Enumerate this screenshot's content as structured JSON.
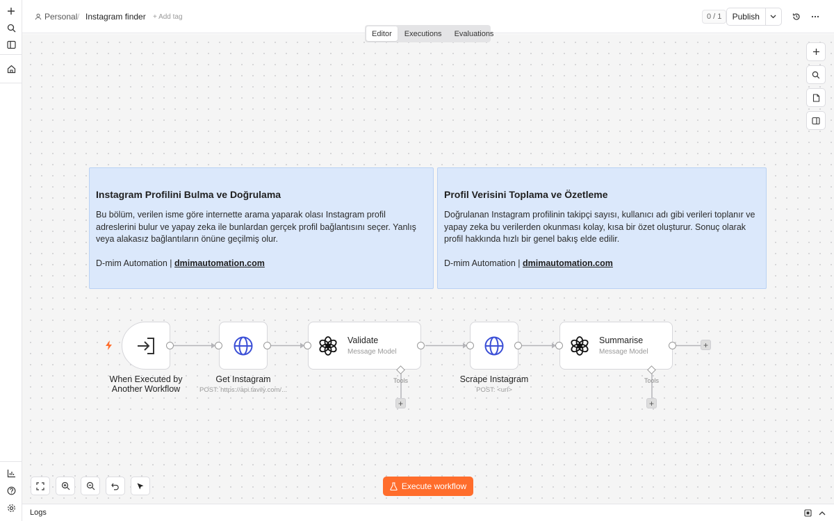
{
  "breadcrumb": {
    "project": "Personal",
    "separator": "/",
    "workflow_name": "Instagram finder",
    "add_tag": "+ Add tag"
  },
  "header": {
    "version_count": "0 / 1",
    "publish_label": "Publish"
  },
  "tabs": [
    {
      "label": "Editor",
      "active": true
    },
    {
      "label": "Executions",
      "active": false
    },
    {
      "label": "Evaluations",
      "active": false
    }
  ],
  "sticky_notes": [
    {
      "title": "Instagram Profilini Bulma ve Doğrulama",
      "body": "Bu bölüm, verilen isme göre internette arama yaparak olası Instagram profil adreslerini bulur ve yapay zeka ile bunlardan gerçek profil bağlantısını seçer. Yanlış veya alakasız bağlantıların önüne geçilmiş olur.",
      "footer_prefix": "D-mim Automation | ",
      "footer_link": "dmimautomation.com"
    },
    {
      "title": "Profil Verisini Toplama ve Özetleme",
      "body": "Doğrulanan Instagram profilinin takipçi sayısı, kullanıcı adı gibi verileri toplanır ve yapay zeka bu verilerden okunması kolay, kısa bir özet oluşturur. Sonuç olarak profil hakkında hızlı bir genel bakış elde edilir.",
      "footer_prefix": "D-mim Automation | ",
      "footer_link": "dmimautomation.com"
    }
  ],
  "nodes": {
    "trigger": {
      "label_line1": "When Executed by",
      "label_line2": "Another Workflow",
      "icon": "enter-arrow-icon"
    },
    "get_instagram": {
      "label": "Get Instagram",
      "sublabel": "POST: https://api.tavily.com/...",
      "icon": "globe-icon"
    },
    "validate": {
      "title": "Validate",
      "subtitle": "Message Model",
      "icon": "openai-icon"
    },
    "scrape_instagram": {
      "label": "Scrape Instagram",
      "sublabel": "POST: <url>",
      "icon": "globe-icon"
    },
    "summarise": {
      "title": "Summarise",
      "subtitle": "Message Model",
      "icon": "openai-icon"
    }
  },
  "tools_label": "Tools",
  "execute_label": "Execute workflow",
  "logs_label": "Logs",
  "colors": {
    "accent": "#ff6d2c",
    "sticky_bg": "#dbe8fb",
    "globe": "#3b4fd6",
    "trigger_bolt": "#ff6d2c"
  }
}
